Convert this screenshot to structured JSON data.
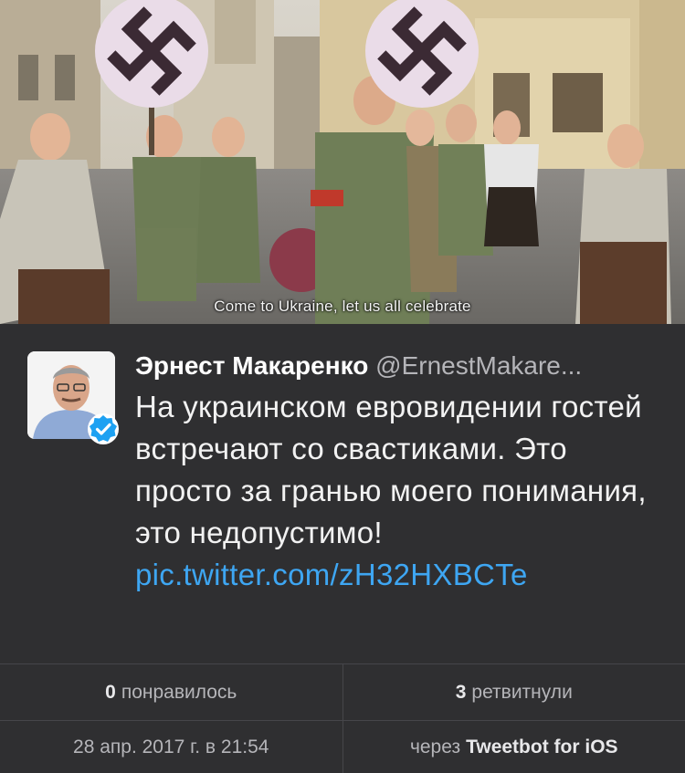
{
  "media": {
    "caption": "Come to Ukraine, let us all celebrate"
  },
  "tweet": {
    "author_name": "Эрнест Макаренко",
    "author_handle": "@ErnestMakare...",
    "text": "На украинском евровидении гостей встречают со свастиками. Это просто за гранью моего понимания, это недопустимо!",
    "link": "pic.twitter.com/zH32HXBCTe",
    "verified": true
  },
  "stats": {
    "likes_count": "0",
    "likes_label": "понравилось",
    "retweets_count": "3",
    "retweets_label": "ретвитнули"
  },
  "meta": {
    "date": "28 апр. 2017 г. в 21:54",
    "via_prefix": "через",
    "client": "Tweetbot for iOS"
  },
  "colors": {
    "background": "#2f2f31",
    "link": "#3ea6f2",
    "verified": "#1da1f2"
  }
}
